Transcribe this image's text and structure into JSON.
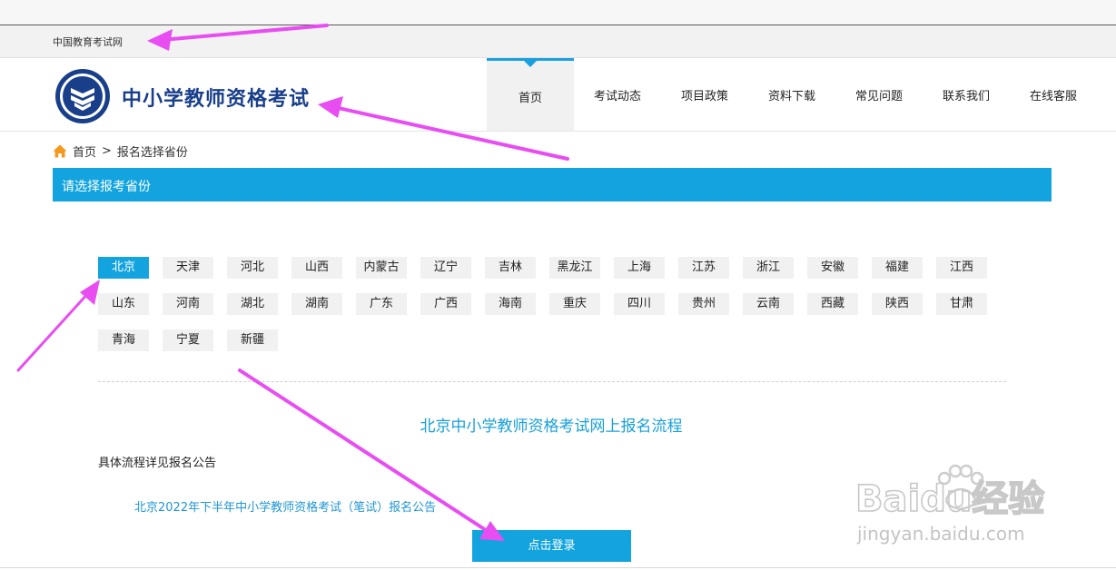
{
  "topbar": {
    "link": "中国教育考试网"
  },
  "header": {
    "title": "中小学教师资格考试",
    "nav": [
      "首页",
      "考试动态",
      "项目政策",
      "资料下载",
      "常见问题",
      "联系我们",
      "在线客服"
    ],
    "active_nav": 0
  },
  "breadcrumb": {
    "home": "首页",
    "sep": ">",
    "current": "报名选择省份"
  },
  "section": {
    "title": "请选择报考省份"
  },
  "provinces": [
    "北京",
    "天津",
    "河北",
    "山西",
    "内蒙古",
    "辽宁",
    "吉林",
    "黑龙江",
    "上海",
    "江苏",
    "浙江",
    "安徽",
    "福建",
    "江西",
    "山东",
    "河南",
    "湖北",
    "湖南",
    "广东",
    "广西",
    "海南",
    "重庆",
    "四川",
    "贵州",
    "云南",
    "西藏",
    "陕西",
    "甘肃",
    "青海",
    "宁夏",
    "新疆"
  ],
  "selected_province": "北京",
  "content": {
    "flow_title": "北京中小学教师资格考试网上报名流程",
    "detail": "具体流程详见报名公告",
    "notice_link": "北京2022年下半年中小学教师资格考试（笔试）报名公告",
    "login_button": "点击登录"
  },
  "watermark": {
    "logo": "Baidu经验",
    "url": "jingyan.baidu.com"
  },
  "colors": {
    "accent": "#13a4df",
    "title_blue": "#1a3f8a",
    "annotation": "#e84df2"
  }
}
